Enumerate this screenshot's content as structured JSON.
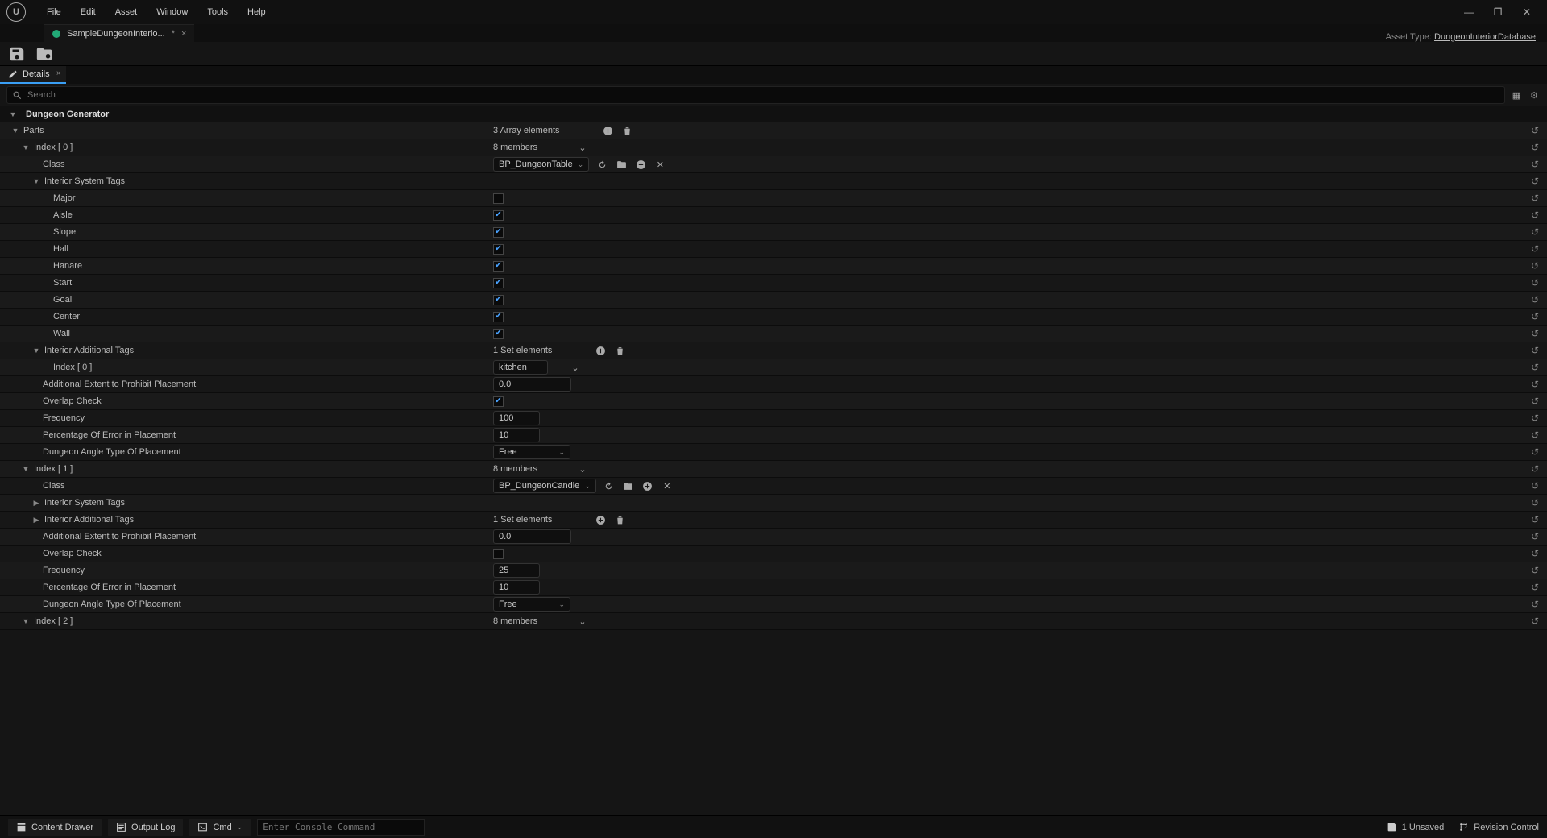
{
  "menu": {
    "file": "File",
    "edit": "Edit",
    "asset": "Asset",
    "window": "Window",
    "tools": "Tools",
    "help": "Help"
  },
  "doc_tab": {
    "title": "SampleDungeonInterio...",
    "dirty": "*"
  },
  "asset_type": {
    "label": "Asset Type:",
    "value": "DungeonInteriorDatabase"
  },
  "panel_tab": "Details",
  "search_placeholder": "Search",
  "section": "Dungeon Generator",
  "labels": {
    "parts": "Parts",
    "index0": "Index [ 0 ]",
    "index1": "Index [ 1 ]",
    "index2": "Index [ 2 ]",
    "class": "Class",
    "ist": "Interior System Tags",
    "major": "Major",
    "aisle": "Aisle",
    "slope": "Slope",
    "hall": "Hall",
    "hanare": "Hanare",
    "start": "Start",
    "goal": "Goal",
    "center": "Center",
    "wall": "Wall",
    "iat": "Interior Additional Tags",
    "iat_idx0": "Index [ 0 ]",
    "addext": "Additional Extent to Prohibit Placement",
    "overlap": "Overlap Check",
    "freq": "Frequency",
    "perr": "Percentage Of Error in Placement",
    "angle": "Dungeon Angle Type Of Placement"
  },
  "values": {
    "parts_count": "3 Array elements",
    "members8": "8 members",
    "class0": "BP_DungeonTable",
    "set1": "1 Set elements",
    "iat_val0": "kitchen",
    "addext0": "0.0",
    "freq0": "100",
    "perr0": "10",
    "angle0": "Free",
    "class1": "BP_DungeonCandle",
    "addext1": "0.0",
    "freq1": "25",
    "perr1": "10",
    "angle1": "Free"
  },
  "status": {
    "drawer": "Content Drawer",
    "output": "Output Log",
    "cmd": "Cmd",
    "console_ph": "Enter Console Command",
    "unsaved": "1 Unsaved",
    "revision": "Revision Control"
  }
}
